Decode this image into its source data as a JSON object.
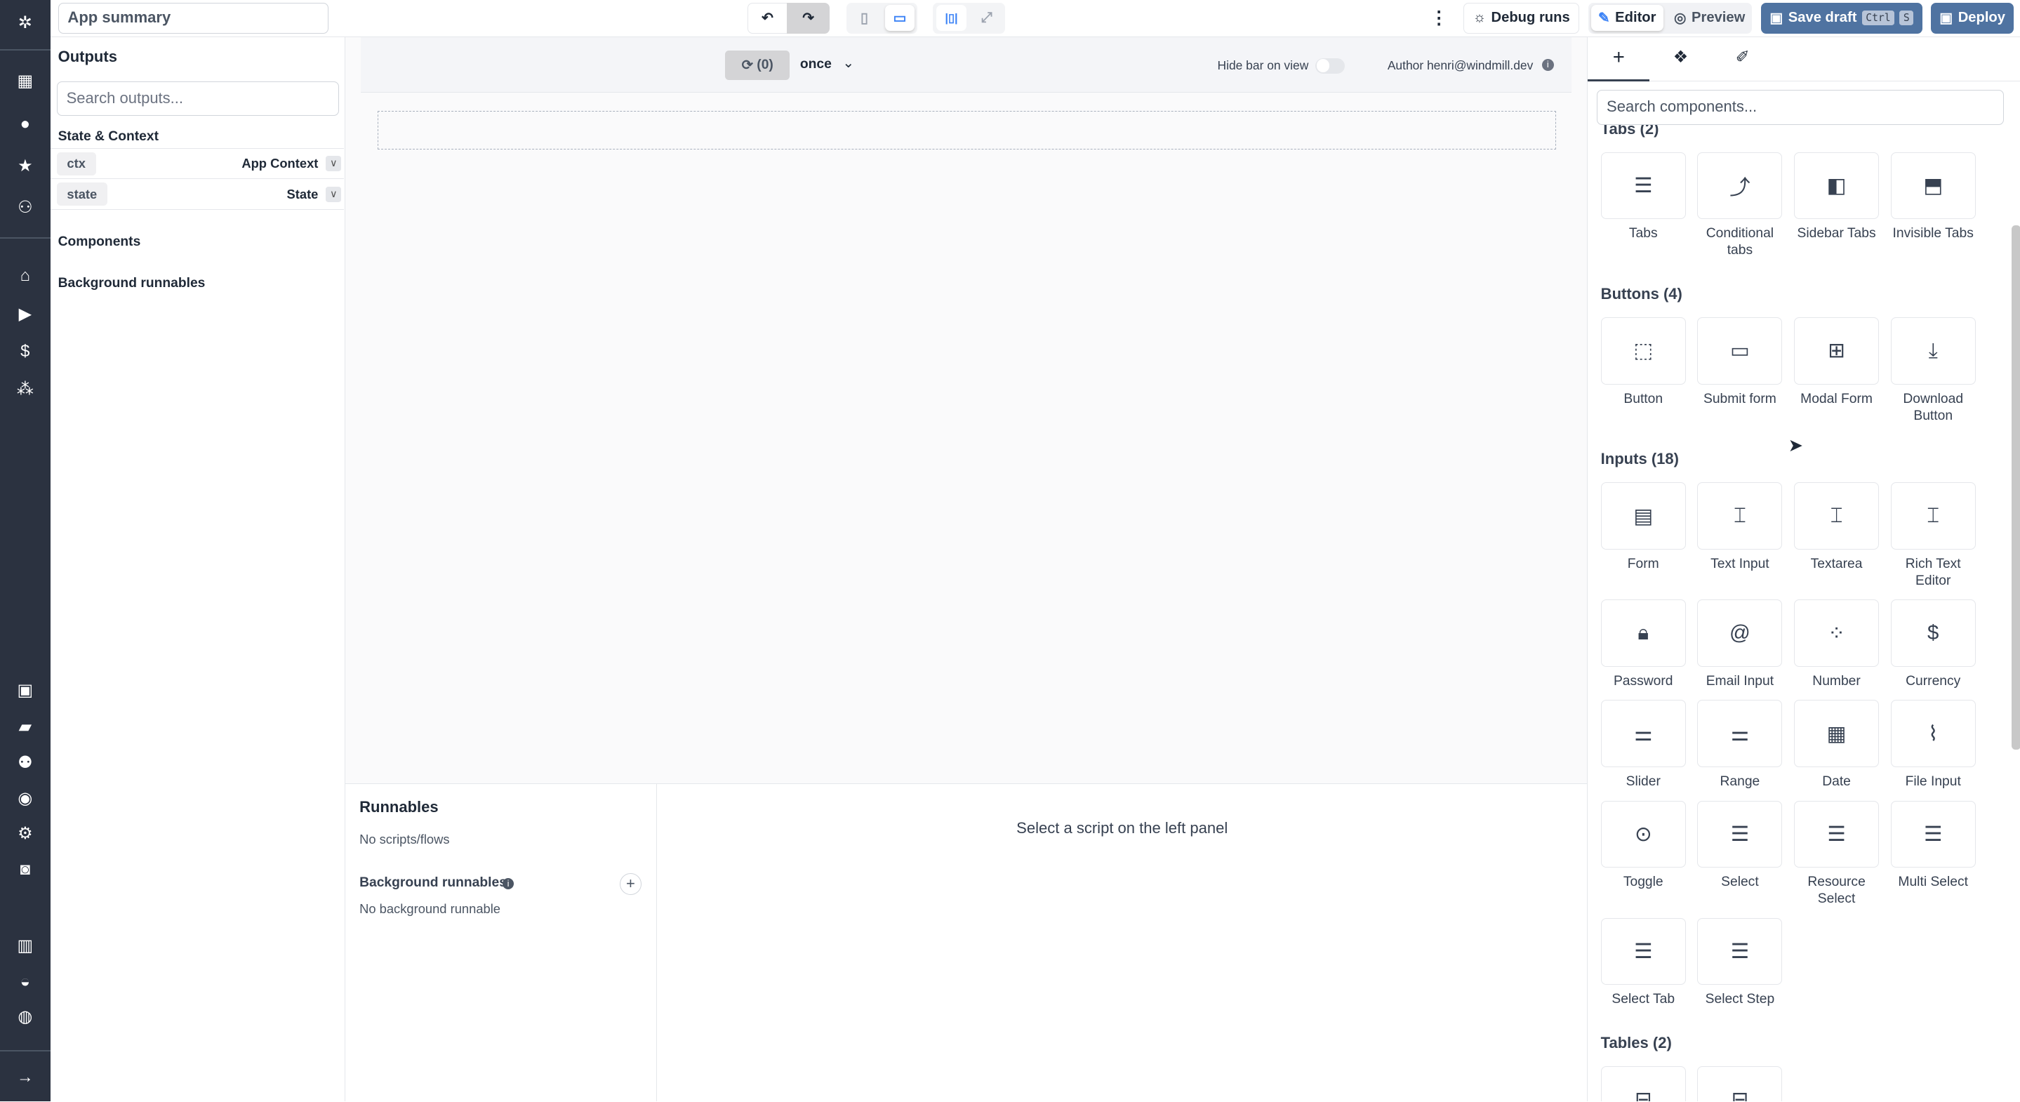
{
  "topbar": {
    "app_title": "App summary",
    "debug_runs": "Debug runs",
    "editor": "Editor",
    "preview": "Preview",
    "save_draft": "Save draft",
    "kbd_ctrl": "Ctrl",
    "kbd_s": "S",
    "deploy": "Deploy",
    "accent": "#4f73a1"
  },
  "left": {
    "title": "Outputs",
    "search_placeholder": "Search outputs...",
    "state_context": "State & Context",
    "rows": [
      {
        "key": "ctx",
        "label": "App Context"
      },
      {
        "key": "state",
        "label": "State"
      }
    ],
    "components": "Components",
    "background": "Background runnables"
  },
  "canvas": {
    "refresh_count": "(0)",
    "frequency": "once",
    "hide_bar": "Hide bar on view",
    "author": "Author henri@windmill.dev"
  },
  "runnables": {
    "title": "Runnables",
    "empty": "No scripts/flows",
    "bg_title": "Background runnables",
    "bg_empty": "No background runnable",
    "detail_empty": "Select a script on the left panel"
  },
  "right": {
    "search_placeholder": "Search components...",
    "sections": [
      {
        "title": "Tabs (2)",
        "items": [
          {
            "label": "Tabs",
            "icon": "list"
          },
          {
            "label": "Conditional tabs",
            "icon": "split"
          },
          {
            "label": "Sidebar Tabs",
            "icon": "sidebar"
          },
          {
            "label": "Invisible Tabs",
            "icon": "window"
          }
        ]
      },
      {
        "title": "Buttons (4)",
        "items": [
          {
            "label": "Button",
            "icon": "pointer"
          },
          {
            "label": "Submit form",
            "icon": "form-input"
          },
          {
            "label": "Modal Form",
            "icon": "plus-square"
          },
          {
            "label": "Download Button",
            "icon": "download"
          }
        ]
      },
      {
        "title": "Inputs (18)",
        "items": [
          {
            "label": "Form",
            "icon": "file-text"
          },
          {
            "label": "Text Input",
            "icon": "text-cursor"
          },
          {
            "label": "Textarea",
            "icon": "text-cursor"
          },
          {
            "label": "Rich Text Editor",
            "icon": "text-cursor"
          },
          {
            "label": "Password",
            "icon": "lock"
          },
          {
            "label": "Email Input",
            "icon": "at"
          },
          {
            "label": "Number",
            "icon": "binary"
          },
          {
            "label": "Currency",
            "icon": "dollar"
          },
          {
            "label": "Slider",
            "icon": "sliders"
          },
          {
            "label": "Range",
            "icon": "sliders"
          },
          {
            "label": "Date",
            "icon": "calendar"
          },
          {
            "label": "File Input",
            "icon": "paperclip"
          },
          {
            "label": "Toggle",
            "icon": "toggle"
          },
          {
            "label": "Select",
            "icon": "list"
          },
          {
            "label": "Resource Select",
            "icon": "list"
          },
          {
            "label": "Multi Select",
            "icon": "list"
          },
          {
            "label": "Select Tab",
            "icon": "list"
          },
          {
            "label": "Select Step",
            "icon": "list"
          }
        ]
      },
      {
        "title": "Tables (2)",
        "items": [
          {
            "label": "",
            "icon": "table"
          },
          {
            "label": "",
            "icon": "table"
          }
        ]
      }
    ]
  }
}
